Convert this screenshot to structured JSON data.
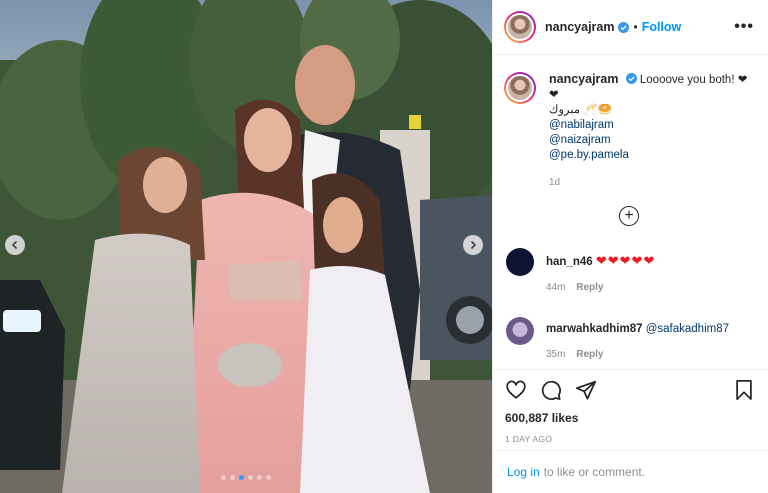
{
  "post": {
    "username": "nancyajram",
    "follow_label": "Follow",
    "separator": "•",
    "more_label": "•••",
    "caption": {
      "username": "nancyajram",
      "text": "Loooove you both! ❤",
      "line2": "❤",
      "line3": "مبروك 🥂🥯",
      "mentions": [
        "@nabilajram",
        "@naizajram",
        "@pe.by.pamela"
      ],
      "time": "1d"
    },
    "comments": [
      {
        "username": "han_n46",
        "text": "❤❤❤❤❤",
        "time": "44m",
        "reply_label": "Reply"
      },
      {
        "username": "marwahkadhim87",
        "text": "@safakadhim87",
        "time": "35m",
        "reply_label": "Reply"
      }
    ],
    "likes": "600,887 likes",
    "date": "1 DAY AGO",
    "login": {
      "link": "Log in",
      "rest": "to like or comment."
    }
  },
  "carousel": {
    "slide_count": 6,
    "active_index": 2
  },
  "colors": {
    "accent": "#0095f6",
    "active_dot": "#3897f0",
    "heart": "#ed1c24"
  },
  "icons": [
    "verified-icon",
    "more-icon",
    "chevron-left-icon",
    "chevron-right-icon",
    "add-circle-icon",
    "heart-icon",
    "comment-icon",
    "share-icon",
    "bookmark-icon"
  ]
}
